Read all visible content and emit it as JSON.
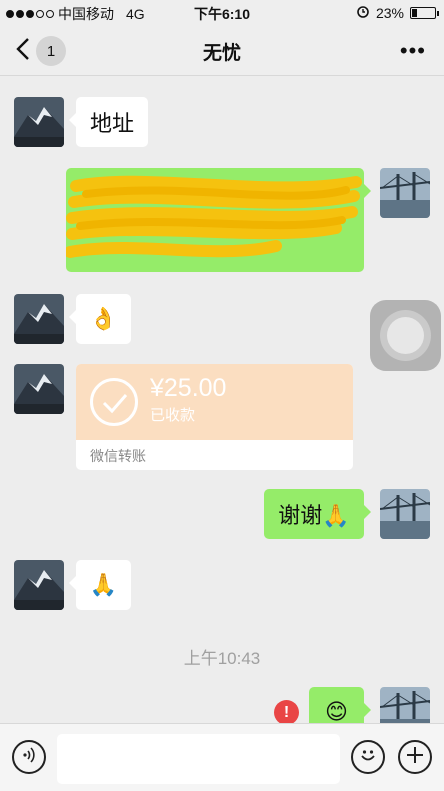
{
  "status_bar": {
    "carrier": "中国移动",
    "network": "4G",
    "time": "下午6:10",
    "battery": "23%",
    "battery_level": 0.23
  },
  "nav": {
    "back_count": "1",
    "title": "无忧",
    "more": "•••"
  },
  "messages": {
    "m1": {
      "text": "地址"
    },
    "m2": {
      "redacted": true
    },
    "m3": {
      "emoji": "👌"
    },
    "m4": {
      "amount": "¥25.00",
      "status": "已收款",
      "footer": "微信转账"
    },
    "m5": {
      "text": "谢谢🙏"
    },
    "m6": {
      "emoji": "🙏"
    },
    "timestamp": "上午10:43",
    "m7": {
      "emoji": "😊",
      "error_mark": "!"
    }
  },
  "colors": {
    "outgoing": "#95ec69",
    "incoming": "#ffffff",
    "transfer": "#fbdec1",
    "error": "#e94545"
  }
}
